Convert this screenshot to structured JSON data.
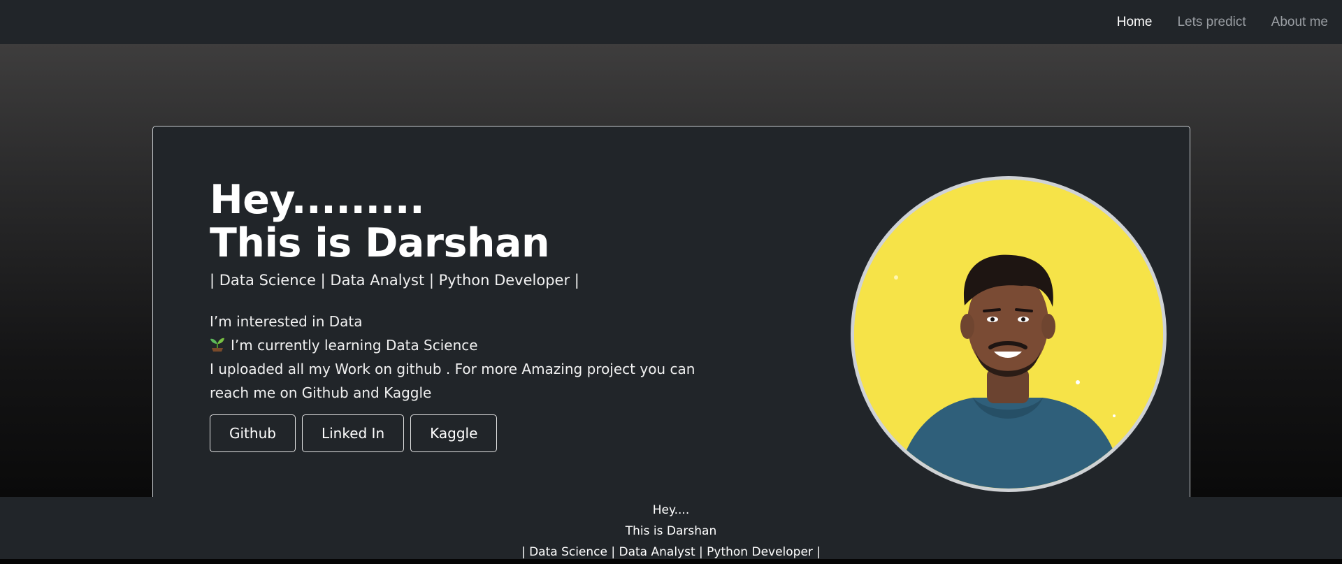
{
  "nav": {
    "items": [
      {
        "label": "Home",
        "active": true
      },
      {
        "label": "Lets predict",
        "active": false
      },
      {
        "label": "About me",
        "active": false
      }
    ]
  },
  "hero": {
    "headline_line1": "Hey.........",
    "headline_line2": "This is Darshan",
    "subtitle": "| Data Science | Data Analyst | Python Developer |",
    "line1": "I’m interested in Data",
    "line2_icon": "seedling-icon",
    "line2": "I’m currently learning Data Science",
    "line3": "I uploaded all my Work on github . For more Amazing project you can reach me on Github and Kaggle",
    "buttons": {
      "github": "Github",
      "linkedin": "Linked In",
      "kaggle": "Kaggle"
    },
    "avatar_background_color": "#f5e24a"
  },
  "footer": {
    "line1": "Hey....",
    "line2": "This is Darshan",
    "line3": "| Data Science | Data Analyst | Python Developer |"
  },
  "colors": {
    "navbar_bg": "#212529",
    "card_bg": "#212529",
    "nav_active": "#ffffff",
    "nav_inactive": "#9a9ea3"
  }
}
